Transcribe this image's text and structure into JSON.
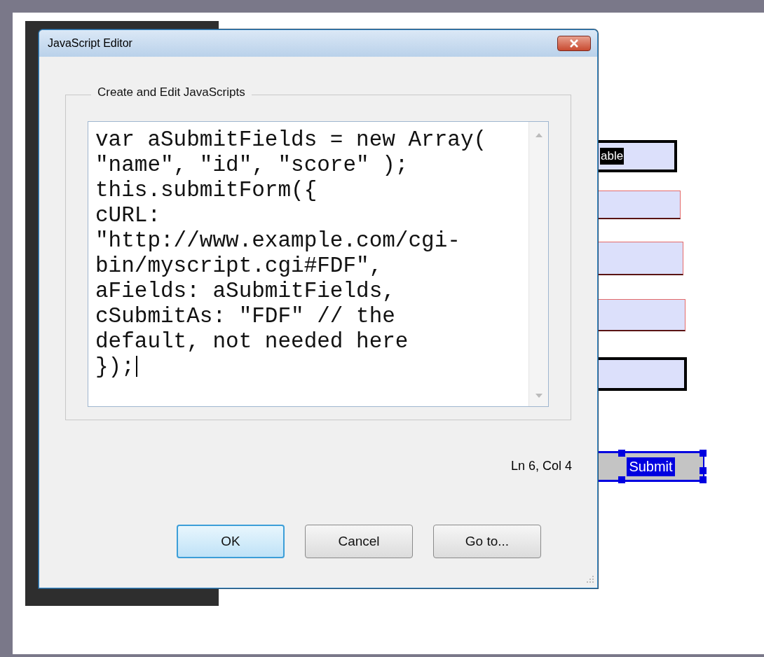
{
  "background_form": {
    "fields": [
      {
        "kind": "text",
        "color": "#000000",
        "value": "able"
      },
      {
        "kind": "text",
        "color": "#e46a6a"
      },
      {
        "kind": "text",
        "color": "#e46a6a"
      },
      {
        "kind": "text",
        "color": "#e46a6a"
      },
      {
        "kind": "text",
        "color": "#000000"
      }
    ],
    "submit_button": {
      "label": "Submit",
      "selected": true
    }
  },
  "dialog": {
    "title": "JavaScript Editor",
    "group_label": "Create and Edit JavaScripts",
    "code_lines": [
      "var aSubmitFields = new Array(",
      "\"name\", \"id\", \"score\" );",
      "this.submitForm({",
      "cURL:",
      "\"http://www.example.com/cgi-",
      "bin/myscript.cgi#FDF\",",
      "aFields: aSubmitFields,",
      "cSubmitAs: \"FDF\" // the",
      "default, not needed here",
      "});"
    ],
    "cursor_position": "Ln 6, Col 4",
    "buttons": [
      {
        "label": "OK",
        "selected": true
      },
      {
        "label": "Cancel",
        "selected": false
      },
      {
        "label": "Go to...",
        "selected": false
      }
    ]
  }
}
